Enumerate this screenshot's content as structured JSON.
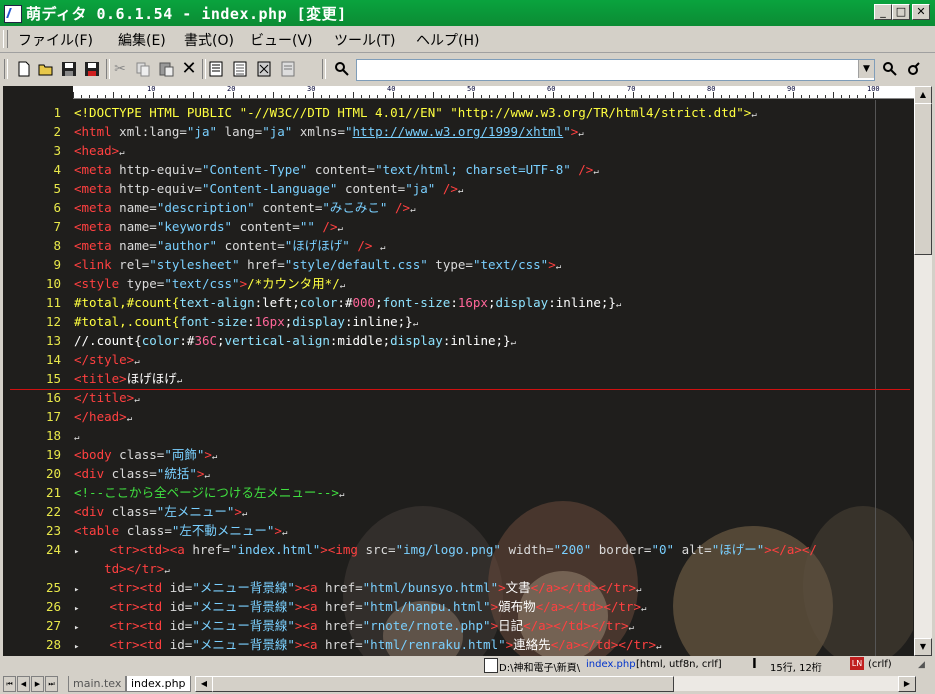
{
  "window": {
    "title": "萌ディタ 0.6.1.54 - index.php [変更]",
    "buttons": {
      "minimize": "_",
      "maximize": "□",
      "close": "✕"
    }
  },
  "menu": [
    {
      "label": "ファイル(F)"
    },
    {
      "label": "編集(E)"
    },
    {
      "label": "書式(O)"
    },
    {
      "label": "ビュー(V)"
    },
    {
      "label": "ツール(T)"
    },
    {
      "label": "ヘルプ(H)"
    }
  ],
  "toolbar": {
    "icons": [
      "new-file-icon",
      "open-folder-icon",
      "save-icon",
      "save-all-icon",
      "cut-icon",
      "copy-icon",
      "paste-icon",
      "delete-icon",
      "page-icon-1",
      "page-icon-2",
      "page-icon-3",
      "page-icon-4"
    ],
    "search_value": "",
    "search_icon": "magnifier-icon",
    "find_icon": "find-icon",
    "settings_icon": "tool-icon"
  },
  "ruler": {
    "numbers": [
      "10",
      "20",
      "30",
      "40",
      "50",
      "60",
      "70",
      "80",
      "90",
      "100"
    ]
  },
  "editor": {
    "current_line": 15,
    "lines": [
      {
        "n": "1",
        "html": "<span class='x'>&lt;!DOCTYPE HTML PUBLIC \"-//W3C//DTD HTML 4.01//EN\" \"http://www.w3.org/TR/html4/strict.dtd\"&gt;</span><span class='eol'>↵</span>"
      },
      {
        "n": "2",
        "html": "<span class='t'>&lt;html</span> <span class='a'>xml:lang=</span><span class='s'>\"ja\"</span> <span class='a'>lang=</span><span class='s'>\"ja\"</span> <span class='a'>xmlns=</span><span class='s'>\"</span><span class='u'>http://www.w3.org/1999/xhtml</span><span class='s'>\"</span><span class='t'>&gt;</span><span class='eol'>↵</span>"
      },
      {
        "n": "3",
        "html": "<span class='t'>&lt;head&gt;</span><span class='eol'>↵</span>"
      },
      {
        "n": "4",
        "html": "<span class='t'>&lt;meta</span> <span class='a'>http-equiv=</span><span class='s'>\"Content-Type\"</span> <span class='a'>content=</span><span class='s'>\"text/html; charset=UTF-8\"</span> <span class='t'>/&gt;</span><span class='eol'>↵</span>"
      },
      {
        "n": "5",
        "html": "<span class='t'>&lt;meta</span> <span class='a'>http-equiv=</span><span class='s'>\"Content-Language\"</span> <span class='a'>content=</span><span class='s'>\"ja\"</span> <span class='t'>/&gt;</span><span class='eol'>↵</span>"
      },
      {
        "n": "6",
        "html": "<span class='t'>&lt;meta</span> <span class='a'>name=</span><span class='s'>\"description\"</span> <span class='a'>content=</span><span class='s'>\"みこみこ\"</span> <span class='t'>/&gt;</span><span class='eol'>↵</span>"
      },
      {
        "n": "7",
        "html": "<span class='t'>&lt;meta</span> <span class='a'>name=</span><span class='s'>\"keywords\"</span> <span class='a'>content=</span><span class='s'>\"\"</span> <span class='t'>/&gt;</span><span class='eol'>↵</span>"
      },
      {
        "n": "8",
        "html": "<span class='t'>&lt;meta</span> <span class='a'>name=</span><span class='s'>\"author\"</span> <span class='a'>content=</span><span class='s'>\"ほげほげ\"</span> <span class='t'>/&gt;</span> <span class='eol'>↵</span>"
      },
      {
        "n": "9",
        "html": "<span class='t'>&lt;link</span> <span class='a'>rel=</span><span class='s'>\"stylesheet\"</span> <span class='a'>href=</span><span class='s'>\"style/default.css\"</span> <span class='a'>type=</span><span class='s'>\"text/css\"</span><span class='t'>&gt;</span><span class='eol'>↵</span>"
      },
      {
        "n": "10",
        "html": "<span class='t'>&lt;style</span> <span class='a'>type=</span><span class='s'>\"text/css\"</span><span class='t'>&gt;</span><span class='x'>/*カウンタ用*/</span><span class='eol'>↵</span>"
      },
      {
        "n": "11",
        "html": "<span class='x'>#total,#count{</span><span class='k'>text-align</span><span class='p'>:left;</span><span class='k'>color</span><span class='p'>:#</span><span class='n'>000</span><span class='p'>;</span><span class='k'>font-size</span><span class='p'>:</span><span class='n'>16px</span><span class='p'>;</span><span class='k'>display</span><span class='p'>:inline;}</span><span class='eol'>↵</span>"
      },
      {
        "n": "12",
        "html": "<span class='x'>#total,.count{</span><span class='k'>font-size</span><span class='p'>:</span><span class='n'>16px</span><span class='p'>;</span><span class='k'>display</span><span class='p'>:inline;}</span><span class='eol'>↵</span>"
      },
      {
        "n": "13",
        "html": "<span class='p'>//.count{</span><span class='k'>color</span><span class='p'>:#</span><span class='n'>36C</span><span class='p'>;</span><span class='k'>vertical-align</span><span class='p'>:middle;</span><span class='k'>display</span><span class='p'>:inline;}</span><span class='eol'>↵</span>"
      },
      {
        "n": "14",
        "html": "<span class='t'>&lt;/style&gt;</span><span class='eol'>↵</span>"
      },
      {
        "n": "15",
        "html": "<span class='t'>&lt;title&gt;</span><span class='p'>ほげほげ</span><span class='eol'>↵</span>"
      },
      {
        "n": "16",
        "html": "<span class='t'>&lt;/title&gt;</span><span class='eol'>↵</span>"
      },
      {
        "n": "17",
        "html": "<span class='t'>&lt;/head&gt;</span><span class='eol'>↵</span>"
      },
      {
        "n": "18",
        "html": "<span class='eol'>↵</span>"
      },
      {
        "n": "19",
        "html": "<span class='t'>&lt;body</span> <span class='a'>class=</span><span class='s'>\"両飾\"</span><span class='t'>&gt;</span><span class='eol'>↵</span>"
      },
      {
        "n": "20",
        "html": "<span class='t'>&lt;div</span> <span class='a'>class=</span><span class='s'>\"統括\"</span><span class='t'>&gt;</span><span class='eol'>↵</span>"
      },
      {
        "n": "21",
        "html": "<span class='c'>&lt;!--ここから全ページにつける左メニュー--&gt;</span><span class='eol'>↵</span>"
      },
      {
        "n": "22",
        "html": "<span class='t'>&lt;div</span> <span class='a'>class=</span><span class='s'>\"左メニュー\"</span><span class='t'>&gt;</span><span class='eol'>↵</span>"
      },
      {
        "n": "23",
        "html": "<span class='t'>&lt;table</span> <span class='a'>class=</span><span class='s'>\"左不動メニュー\"</span><span class='t'>&gt;</span><span class='eol'>↵</span>"
      },
      {
        "n": "24",
        "html": "<span class='eol'>▸</span>    <span class='t'>&lt;tr&gt;&lt;td&gt;&lt;a</span> <span class='a'>href=</span><span class='s'>\"index.html\"</span><span class='t'>&gt;&lt;img</span> <span class='a'>src=</span><span class='s'>\"img/logo.png\"</span> <span class='a'>width=</span><span class='s'>\"200\"</span> <span class='a'>border=</span><span class='s'>\"0\"</span> <span class='a'>alt=</span><span class='s'>\"ほげー\"</span><span class='t'>&gt;&lt;/a&gt;&lt;/</span>"
      },
      {
        "n": "",
        "html": "    <span class='t'>td&gt;&lt;/tr&gt;</span><span class='eol'>↵</span>"
      },
      {
        "n": "25",
        "html": "<span class='eol'>▸</span>    <span class='t'>&lt;tr&gt;&lt;td</span> <span class='a'>id=</span><span class='s'>\"メニュー背景線\"</span><span class='t'>&gt;&lt;a</span> <span class='a'>href=</span><span class='s'>\"html/bunsyo.html\"</span><span class='t'>&gt;</span><span class='p'>文書</span><span class='t'>&lt;/a&gt;&lt;/td&gt;&lt;/tr&gt;</span><span class='eol'>↵</span>"
      },
      {
        "n": "26",
        "html": "<span class='eol'>▸</span>    <span class='t'>&lt;tr&gt;&lt;td</span> <span class='a'>id=</span><span class='s'>\"メニュー背景線\"</span><span class='t'>&gt;&lt;a</span> <span class='a'>href=</span><span class='s'>\"html/hanpu.html\"</span><span class='t'>&gt;</span><span class='p'>頒布物</span><span class='t'>&lt;/a&gt;&lt;/td&gt;&lt;/tr&gt;</span><span class='eol'>↵</span>"
      },
      {
        "n": "27",
        "html": "<span class='eol'>▸</span>    <span class='t'>&lt;tr&gt;&lt;td</span> <span class='a'>id=</span><span class='s'>\"メニュー背景線\"</span><span class='t'>&gt;&lt;a</span> <span class='a'>href=</span><span class='s'>\"rnote/rnote.php\"</span><span class='t'>&gt;</span><span class='p'>日記</span><span class='t'>&lt;/a&gt;&lt;/td&gt;&lt;/tr&gt;</span><span class='eol'>↵</span>"
      },
      {
        "n": "28",
        "html": "<span class='eol'>▸</span>    <span class='t'>&lt;tr&gt;&lt;td</span> <span class='a'>id=</span><span class='s'>\"メニュー背景線\"</span><span class='t'>&gt;&lt;a</span> <span class='a'>href=</span><span class='s'>\"html/renraku.html\"</span><span class='t'>&gt;</span><span class='p'>連絡先</span><span class='t'>&lt;/a&gt;&lt;/td&gt;&lt;/tr&gt;</span><span class='eol'>↵</span>"
      }
    ]
  },
  "status": {
    "path": "D:\\神和電子\\新頁\\",
    "file": "index.php",
    "meta": "[html, utf8n, crlf]",
    "position": "15行, 12桁",
    "newline": "(crlf)"
  },
  "tabs": [
    {
      "label": "main.tex",
      "active": false
    },
    {
      "label": "index.php",
      "active": true
    }
  ]
}
